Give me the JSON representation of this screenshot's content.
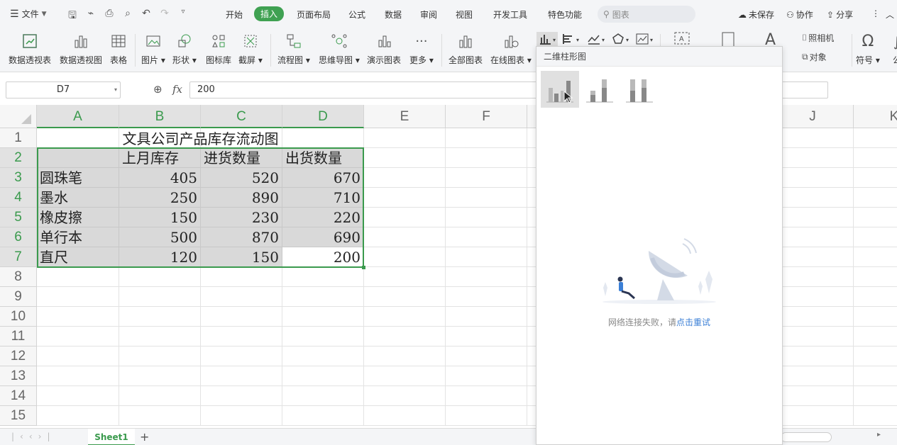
{
  "menubar": {
    "file_label": "文件",
    "tabs": [
      "开始",
      "插入",
      "页面布局",
      "公式",
      "数据",
      "审阅",
      "视图",
      "开发工具",
      "特色功能"
    ],
    "active_tab": "插入",
    "search_placeholder": "图表",
    "unsaved_label": "未保存",
    "collab_label": "协作",
    "share_label": "分享"
  },
  "ribbon": {
    "pivot_table": "数据透视表",
    "pivot_chart": "数据透视图",
    "table": "表格",
    "picture": "图片",
    "shape": "形状",
    "icon_lib": "图标库",
    "screenshot": "截屏",
    "flowchart": "流程图",
    "mindmap": "思维导图",
    "demo_chart": "演示图表",
    "more": "更多",
    "all_charts": "全部图表",
    "online_charts": "在线图表",
    "camera": "照相机",
    "object": "对象",
    "symbol": "符号",
    "formula": "公"
  },
  "formula_bar": {
    "name_box": "D7",
    "fx_label": "fx",
    "value": "200"
  },
  "columns": [
    "A",
    "B",
    "C",
    "D",
    "E",
    "F",
    "G",
    "H",
    "I",
    "J",
    "K"
  ],
  "rows": [
    "1",
    "2",
    "3",
    "4",
    "5",
    "6",
    "7",
    "8",
    "9",
    "10",
    "11",
    "12",
    "13",
    "14",
    "15"
  ],
  "sheet": {
    "title": "文具公司产品库存流动图",
    "headers": [
      "",
      "上月库存",
      "进货数量",
      "出货数量"
    ],
    "data": [
      [
        "圆珠笔",
        "405",
        "520",
        "670"
      ],
      [
        "墨水",
        "250",
        "890",
        "710"
      ],
      [
        "橡皮擦",
        "150",
        "230",
        "220"
      ],
      [
        "单行本",
        "500",
        "870",
        "690"
      ],
      [
        "直尺",
        "120",
        "150",
        "200"
      ]
    ]
  },
  "dropdown": {
    "title": "二维柱形图",
    "chart_types": [
      "clustered-column",
      "stacked-column",
      "percent-stacked-column"
    ],
    "error_text": "网络连接失败，请",
    "retry_text": "点击重试"
  },
  "status": {
    "sheet_tab": "Sheet1",
    "add_sheet": "+"
  },
  "colors": {
    "accent": "#3a9a4d",
    "link": "#3b7fd6"
  }
}
